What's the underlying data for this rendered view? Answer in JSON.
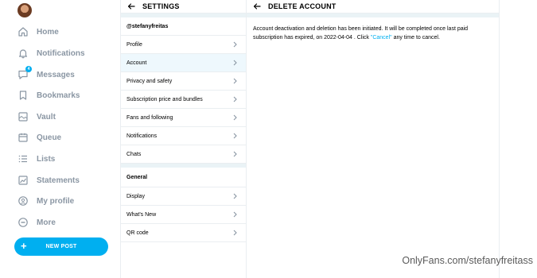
{
  "nav": {
    "items": [
      {
        "label": "Home",
        "icon": "home-icon"
      },
      {
        "label": "Notifications",
        "icon": "bell-icon"
      },
      {
        "label": "Messages",
        "icon": "message-icon",
        "badge": "4"
      },
      {
        "label": "Bookmarks",
        "icon": "bookmark-icon"
      },
      {
        "label": "Vault",
        "icon": "vault-icon"
      },
      {
        "label": "Queue",
        "icon": "calendar-icon"
      },
      {
        "label": "Lists",
        "icon": "list-icon"
      },
      {
        "label": "Statements",
        "icon": "chart-icon"
      },
      {
        "label": "My profile",
        "icon": "profile-icon"
      },
      {
        "label": "More",
        "icon": "more-icon"
      }
    ],
    "new_post_label": "NEW POST"
  },
  "settings": {
    "title": "SETTINGS",
    "username": "@stefanyfreitas",
    "account_items": [
      {
        "label": "Profile"
      },
      {
        "label": "Account",
        "active": true
      },
      {
        "label": "Privacy and safety"
      },
      {
        "label": "Subscription price and bundles"
      },
      {
        "label": "Fans and following"
      },
      {
        "label": "Notifications"
      },
      {
        "label": "Chats"
      }
    ],
    "general_label": "General",
    "general_items": [
      {
        "label": "Display"
      },
      {
        "label": "What's New"
      },
      {
        "label": "QR code"
      }
    ]
  },
  "delete_account": {
    "title": "DELETE ACCOUNT",
    "notice_before": "Account deactivation and deletion has been initiated. It will be completed once last paid subscription has expired, on 2022-04-04 . Click ",
    "cancel_link": "\"Cancel\"",
    "notice_after": " any time to cancel."
  },
  "watermark": "OnlyFans.com/stefanyfreitass",
  "colors": {
    "accent": "#00aff0",
    "nav_text": "#8a96a3",
    "divider": "#eaeef1",
    "active_row": "#eef8fd"
  }
}
